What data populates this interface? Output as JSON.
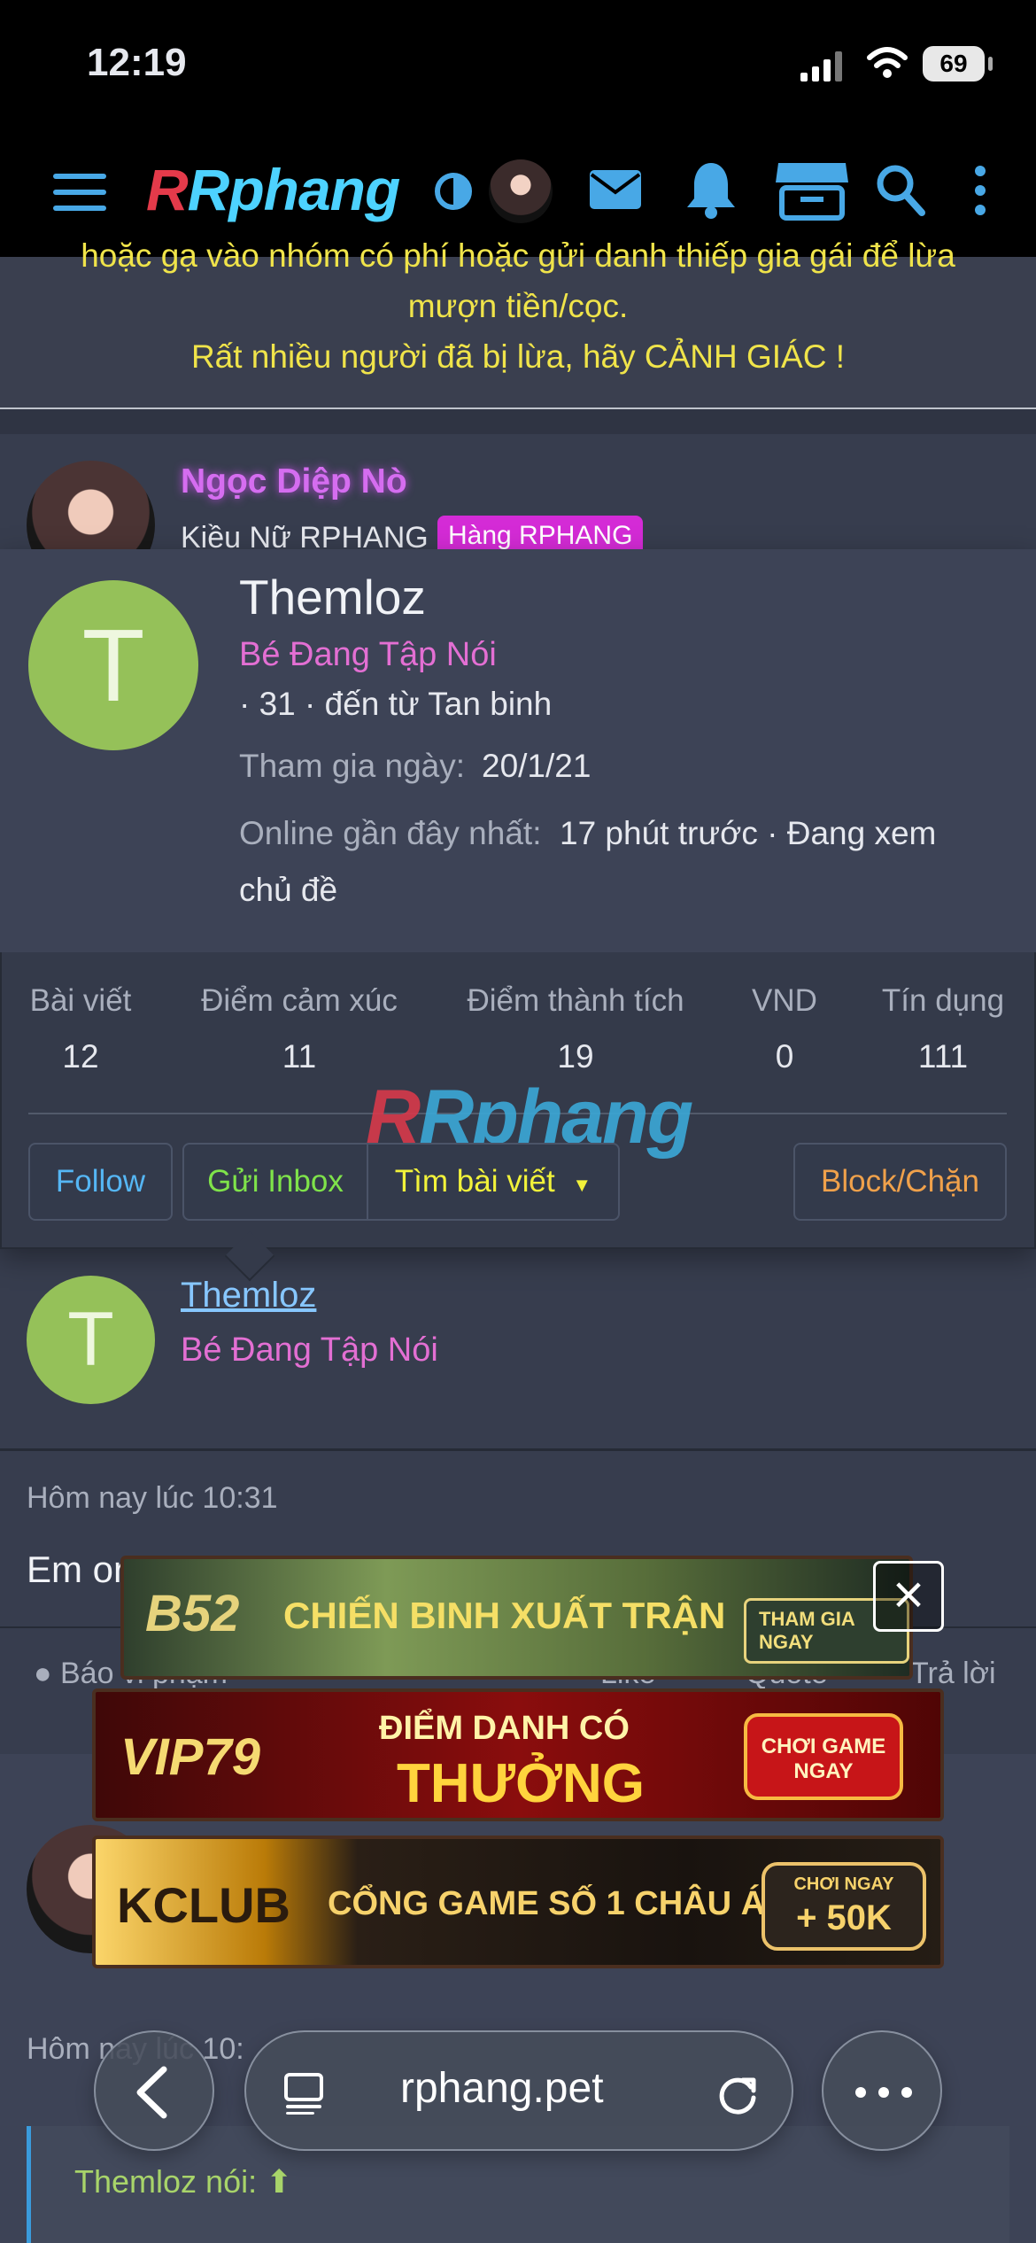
{
  "status_bar": {
    "time": "12:19",
    "battery": "69"
  },
  "header": {
    "logo": "Rphang"
  },
  "alert": {
    "line1": "hoặc gạ vào nhóm có phí hoặc gửi danh thiếp gia gái để lừa",
    "line2": "mượn tiền/cọc.",
    "line3": "Rất nhiều người đã bị lừa, hãy CẢNH GIÁC !"
  },
  "poster": {
    "name": "Ngọc Diệp Nò",
    "title": "Kiều Nữ RPHANG",
    "badge": "Hàng RPHANG"
  },
  "popup": {
    "avatar_letter": "T",
    "name": "Themloz",
    "role": "Bé Đang Tập Nói",
    "location": "· 31 · đến từ Tan binh",
    "join_label": "Tham gia ngày:",
    "join_value": "20/1/21",
    "online_label": "Online gần đây nhất:",
    "online_value": "17 phút trước · Đang xem",
    "online_value2": "chủ đề",
    "stats": [
      {
        "label": "Bài viết",
        "value": "12"
      },
      {
        "label": "Điểm cảm xúc",
        "value": "11"
      },
      {
        "label": "Điểm thành tích",
        "value": "19"
      },
      {
        "label": "VND",
        "value": "0"
      },
      {
        "label": "Tín dụng",
        "value": "111"
      }
    ],
    "watermark": "Rphang",
    "buttons": {
      "follow": "Follow",
      "inbox": "Gửi Inbox",
      "search": "Tìm bài viết",
      "block": "Block/Chặn"
    }
  },
  "author": {
    "avatar_letter": "T",
    "name": "Themloz",
    "role": "Bé Đang Tập Nói"
  },
  "post": {
    "time": "Hôm nay lúc 10:31",
    "body": "Em or",
    "report": "Báo vi phạm",
    "like": "Like",
    "quote": "Quote",
    "reply": "Trả lời"
  },
  "ads": {
    "ad1_brand": "B52",
    "ad1_text": "CHIẾN BINH XUẤT TRẬN",
    "ad1_button": "THAM GIA NGAY",
    "ad2_brand": "VIP79",
    "ad2_text1": "ĐIỂM DANH CÓ",
    "ad2_text2": "THƯỞNG",
    "ad2_button": "CHƠI GAME NGAY",
    "ad3_brand": "KCLUB",
    "ad3_text": "CỔNG GAME SỐ 1 CHÂU Á",
    "ad3_small": "CHƠI NGAY",
    "ad3_bonus": "+ 50K"
  },
  "next_post": {
    "time": "Hôm nay lúc 10:",
    "quote": "Themloz nói:"
  },
  "browser": {
    "url": "rphang.pet"
  },
  "colors": {
    "header_blue": "#48a8e6",
    "role_pink": "#e36fd3",
    "follow_blue": "#55b6f4",
    "inbox_green": "#7fe34a",
    "search_yellow": "#f2f23a",
    "block_orange": "#f0a14b"
  }
}
